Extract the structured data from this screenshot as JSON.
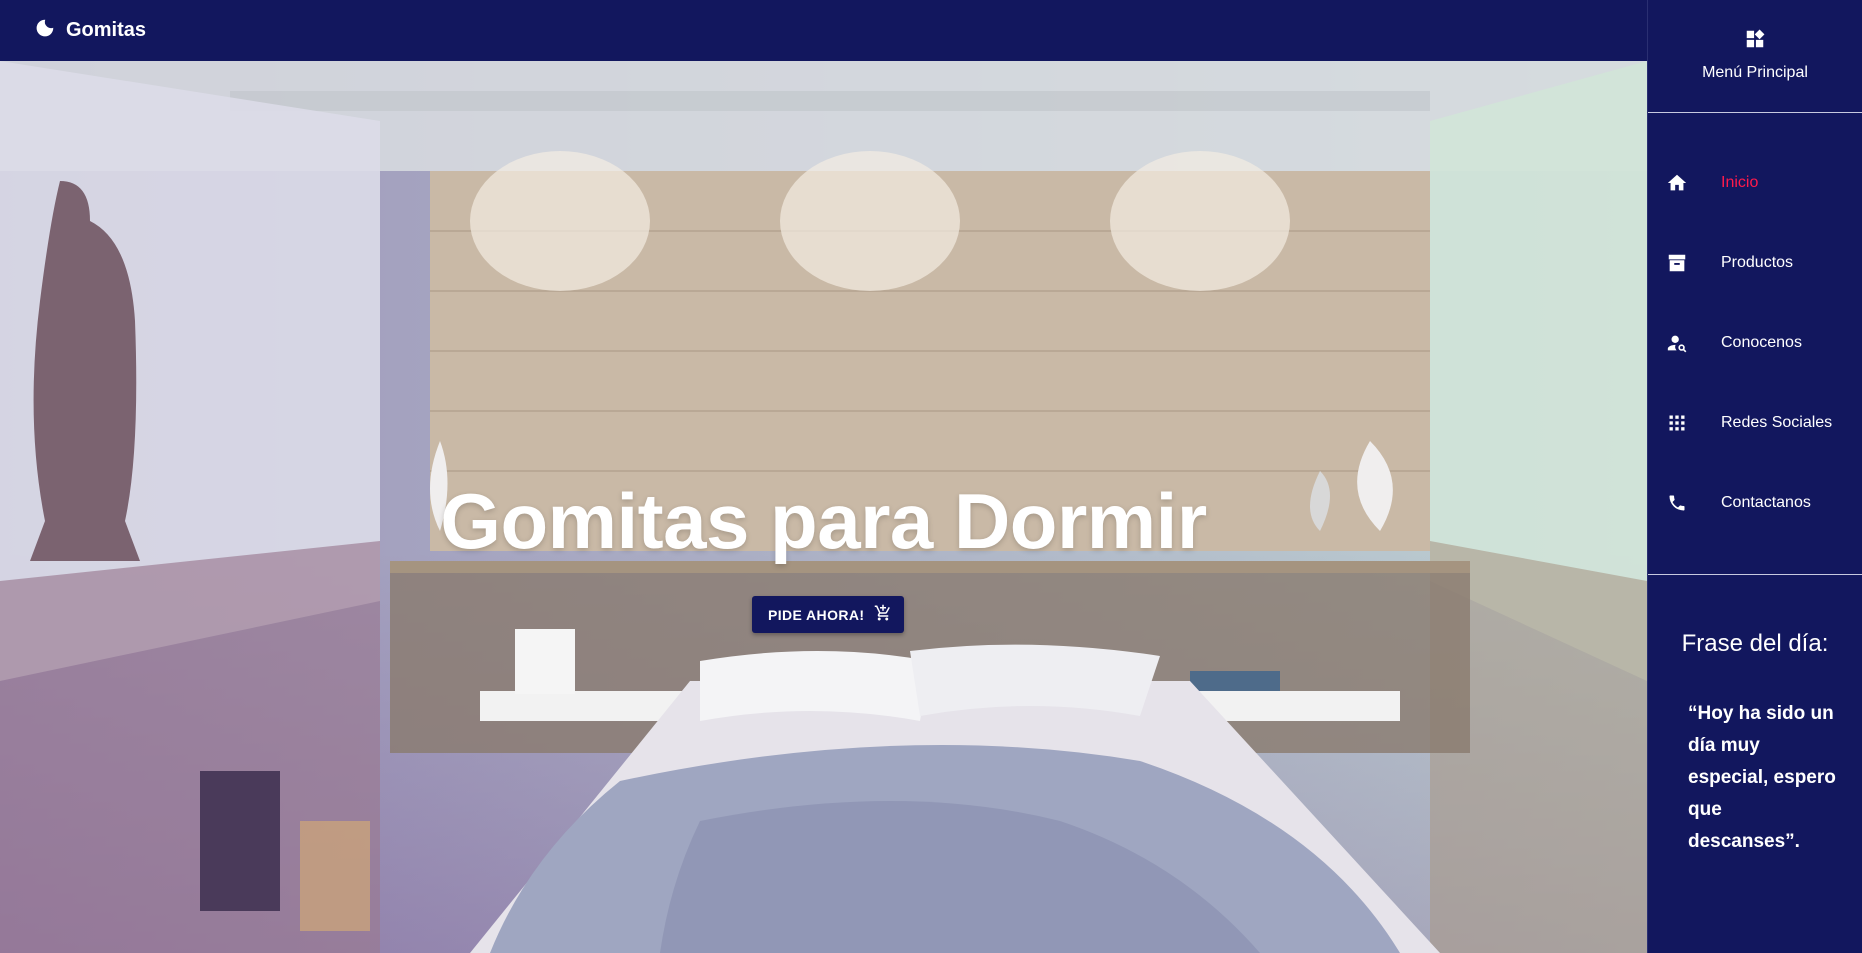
{
  "app": {
    "brand": "Gomitas",
    "brand_icon": "moon-icon"
  },
  "hero": {
    "title": "Gomitas para Dormir",
    "cta_label": "PIDE AHORA!",
    "cta_icon": "cart-add-icon"
  },
  "sidebar": {
    "header_label": "Menú Principal",
    "header_icon": "dashboard-icon",
    "items": [
      {
        "label": "Inicio",
        "icon": "home-icon",
        "active": true
      },
      {
        "label": "Productos",
        "icon": "archive-icon",
        "active": false
      },
      {
        "label": "Conocenos",
        "icon": "person-search-icon",
        "active": false
      },
      {
        "label": "Redes Sociales",
        "icon": "apps-icon",
        "active": false
      },
      {
        "label": "Contactanos",
        "icon": "phone-icon",
        "active": false
      }
    ],
    "quote_title": "Frase del día:",
    "quote_text": "“Hoy ha sido un día muy especial, espero que descanses”."
  },
  "colors": {
    "navy": "#12175e",
    "active": "#ff1a4b",
    "white": "#ffffff"
  }
}
